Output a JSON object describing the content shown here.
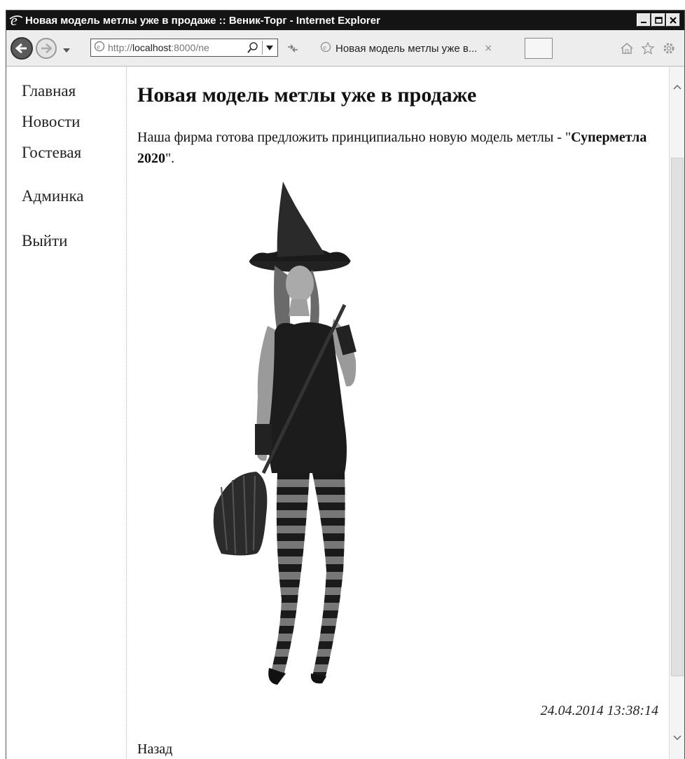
{
  "window": {
    "title": "Новая модель метлы уже в продаже :: Веник-Торг - Internet Explorer"
  },
  "toolbar": {
    "address_prefix": "http://",
    "address_host": "localhost",
    "address_rest": ":8000/ne",
    "tab_title": "Новая модель метлы уже в...",
    "tab_close": "×"
  },
  "sidebar": {
    "items": [
      {
        "label": "Главная"
      },
      {
        "label": "Новости"
      },
      {
        "label": "Гостевая"
      },
      {
        "label": "Админка"
      },
      {
        "label": "Выйти"
      }
    ]
  },
  "article": {
    "title": "Новая модель метлы уже в продаже",
    "lead_text": "Наша фирма готова предложить принципиально новую модель метлы - \"",
    "product_name": "Суперметла 2020",
    "lead_end": "\".",
    "date": "24.04.2014 13:38:14",
    "back_link": "Назад"
  },
  "icons": [
    "ie-logo-icon",
    "minimize-icon",
    "maximize-icon",
    "close-icon",
    "back-arrow-icon",
    "forward-arrow-icon",
    "search-icon",
    "refresh-icon",
    "home-icon",
    "favorites-star-icon",
    "settings-gear-icon"
  ]
}
